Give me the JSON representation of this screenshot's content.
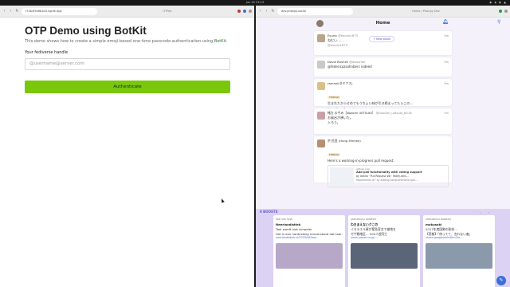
{
  "system": {
    "clock": "Jun 20 23:13",
    "tray": "◉ ◈ ◐ ▲"
  },
  "left": {
    "url": "f74b4f5e6b1d4.ngrok.app",
    "tab": "OTPoe",
    "title": "OTP Demo using BotKit",
    "desc_before": "This demo shows how to create a simple emoji-based one-time passcode authentication using ",
    "desc_link": "BotKit",
    "desc_after": ".",
    "label": "Your fediverse handle",
    "placeholder": "@username@server.com",
    "button": "Authenticate"
  },
  "right": {
    "url": "dev.phanpy.social",
    "tab": "Home / Phanpy Dev",
    "home": "Home",
    "new_posts": "New posts",
    "posts": [
      {
        "name": "Esurio",
        "handle": "@esurio1673",
        "time": "5m",
        "text": "ねむい……",
        "tag": ""
      },
      {
        "name": "",
        "handle": "@esurio1673",
        "time": "",
        "text": "",
        "tag": ""
      },
      {
        "name": "David Bushell",
        "handle": "@dbushell",
        "time": "5m",
        "text": "@federicozsohnbers indeed",
        "tag": ""
      },
      {
        "name": "ramnel(タミアス)",
        "handle": "",
        "time": "5m",
        "text": "生まれたからせめてもうちょい味が引き締まってたらこの…",
        "tag": "THREAD"
      },
      {
        "name": "緒方 のぞみ［Nozomi UETSUKI］",
        "handle": "@nozomi_uetsuki_8418",
        "time": "5m",
        "text": "お風呂が沸いた。",
        "tag": ""
      },
      {
        "name": "",
        "handle": "",
        "time": "",
        "text": "入ろう。",
        "tag": ""
      },
      {
        "name": "洪 民憙 (Hong Minhee)",
        "handle": "",
        "time": "",
        "text": "Here's a working-in-progress pull request:",
        "tag": "THREAD"
      }
    ],
    "link_card": {
      "host": "github.com",
      "title": "Add poll functionality with voting support",
      "sub": "by dahlia · Pull Request #8 · fedify-dev/…",
      "desc": "Implements #7 by adding comprehensive poll…"
    },
    "boosts_label": "8 BOOSTS",
    "boosts": [
      {
        "booster": "Yolk van Ijzijk",
        "user": "Neerlandistiek",
        "text": "Taal wordt niet simpeler",
        "body": "Het is een hardnekkig misverstand dat taal zich",
        "link": "neerlandistiek.nl/2025/06/taal…"
      },
      {
        "booster": "zalauseusu boosted",
        "user": "わきまえないクこの",
        "text": "イスラエル軍が緊急宣言で基地を",
        "body": "ガザ戦地区… 500人超死亡",
        "link": "news.yahoo.co.jp/…"
      },
      {
        "booster": "zalauseusu boosted",
        "user": "mokusaki",
        "text": "2017年度国勢の割合…",
        "body": "【悲報】「待ってて、言わない者」",
        "link": "share.google/ohbHAm1ta…"
      }
    ]
  }
}
